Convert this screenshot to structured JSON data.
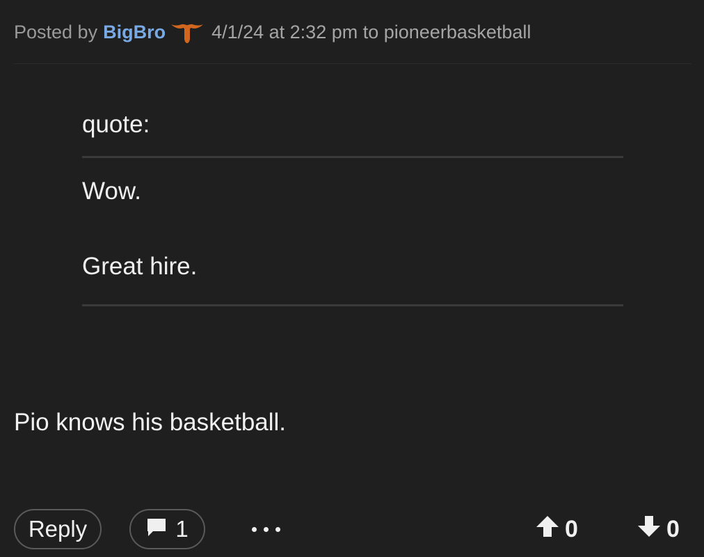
{
  "post": {
    "posted_by_label": "Posted by",
    "username": "BigBro",
    "team_icon": "longhorn-icon",
    "meta": "4/1/24 at 2:32 pm to pioneerbasketball",
    "quote_label": "quote:",
    "quote_lines": [
      "Wow.",
      "Great hire."
    ],
    "body": "Pio knows his basketball."
  },
  "footer": {
    "reply_label": "Reply",
    "comment_count": "1",
    "upvotes": "0",
    "downvotes": "0"
  },
  "colors": {
    "background": "#1f1f1f",
    "username": "#79a9e3",
    "team_icon": "#d1671f"
  }
}
